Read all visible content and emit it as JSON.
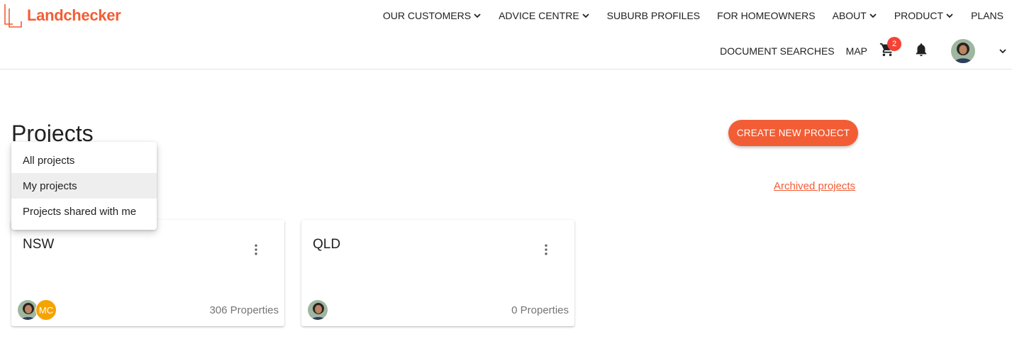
{
  "brand": {
    "name": "Landchecker",
    "color": "#f25d35"
  },
  "nav": {
    "primary": [
      {
        "label": "OUR CUSTOMERS",
        "dropdown": true
      },
      {
        "label": "ADVICE CENTRE",
        "dropdown": true
      },
      {
        "label": "SUBURB PROFILES",
        "dropdown": false
      },
      {
        "label": "FOR HOMEOWNERS",
        "dropdown": false
      },
      {
        "label": "ABOUT",
        "dropdown": true
      },
      {
        "label": "PRODUCT",
        "dropdown": true
      },
      {
        "label": "PLANS",
        "dropdown": false
      }
    ],
    "secondary": {
      "document_searches": "DOCUMENT SEARCHES",
      "map": "MAP",
      "cart_count": "2",
      "icons": [
        "cart-icon",
        "bell-icon",
        "avatar",
        "chevron-down-icon"
      ]
    }
  },
  "page": {
    "title": "Projects",
    "create_button": "CREATE NEW PROJECT",
    "archived_link": "Archived projects"
  },
  "filter_menu": {
    "items": [
      "All projects",
      "My projects",
      "Projects shared with me"
    ],
    "selected": "My projects"
  },
  "projects": [
    {
      "name": "NSW",
      "properties": "306 Properties",
      "members": [
        "avatar",
        "MC"
      ]
    },
    {
      "name": "QLD",
      "properties": "0 Properties",
      "members": [
        "avatar"
      ]
    }
  ],
  "colors": {
    "accent": "#f25d35",
    "badge": "#f44336",
    "mc_avatar": "#f5a300"
  }
}
